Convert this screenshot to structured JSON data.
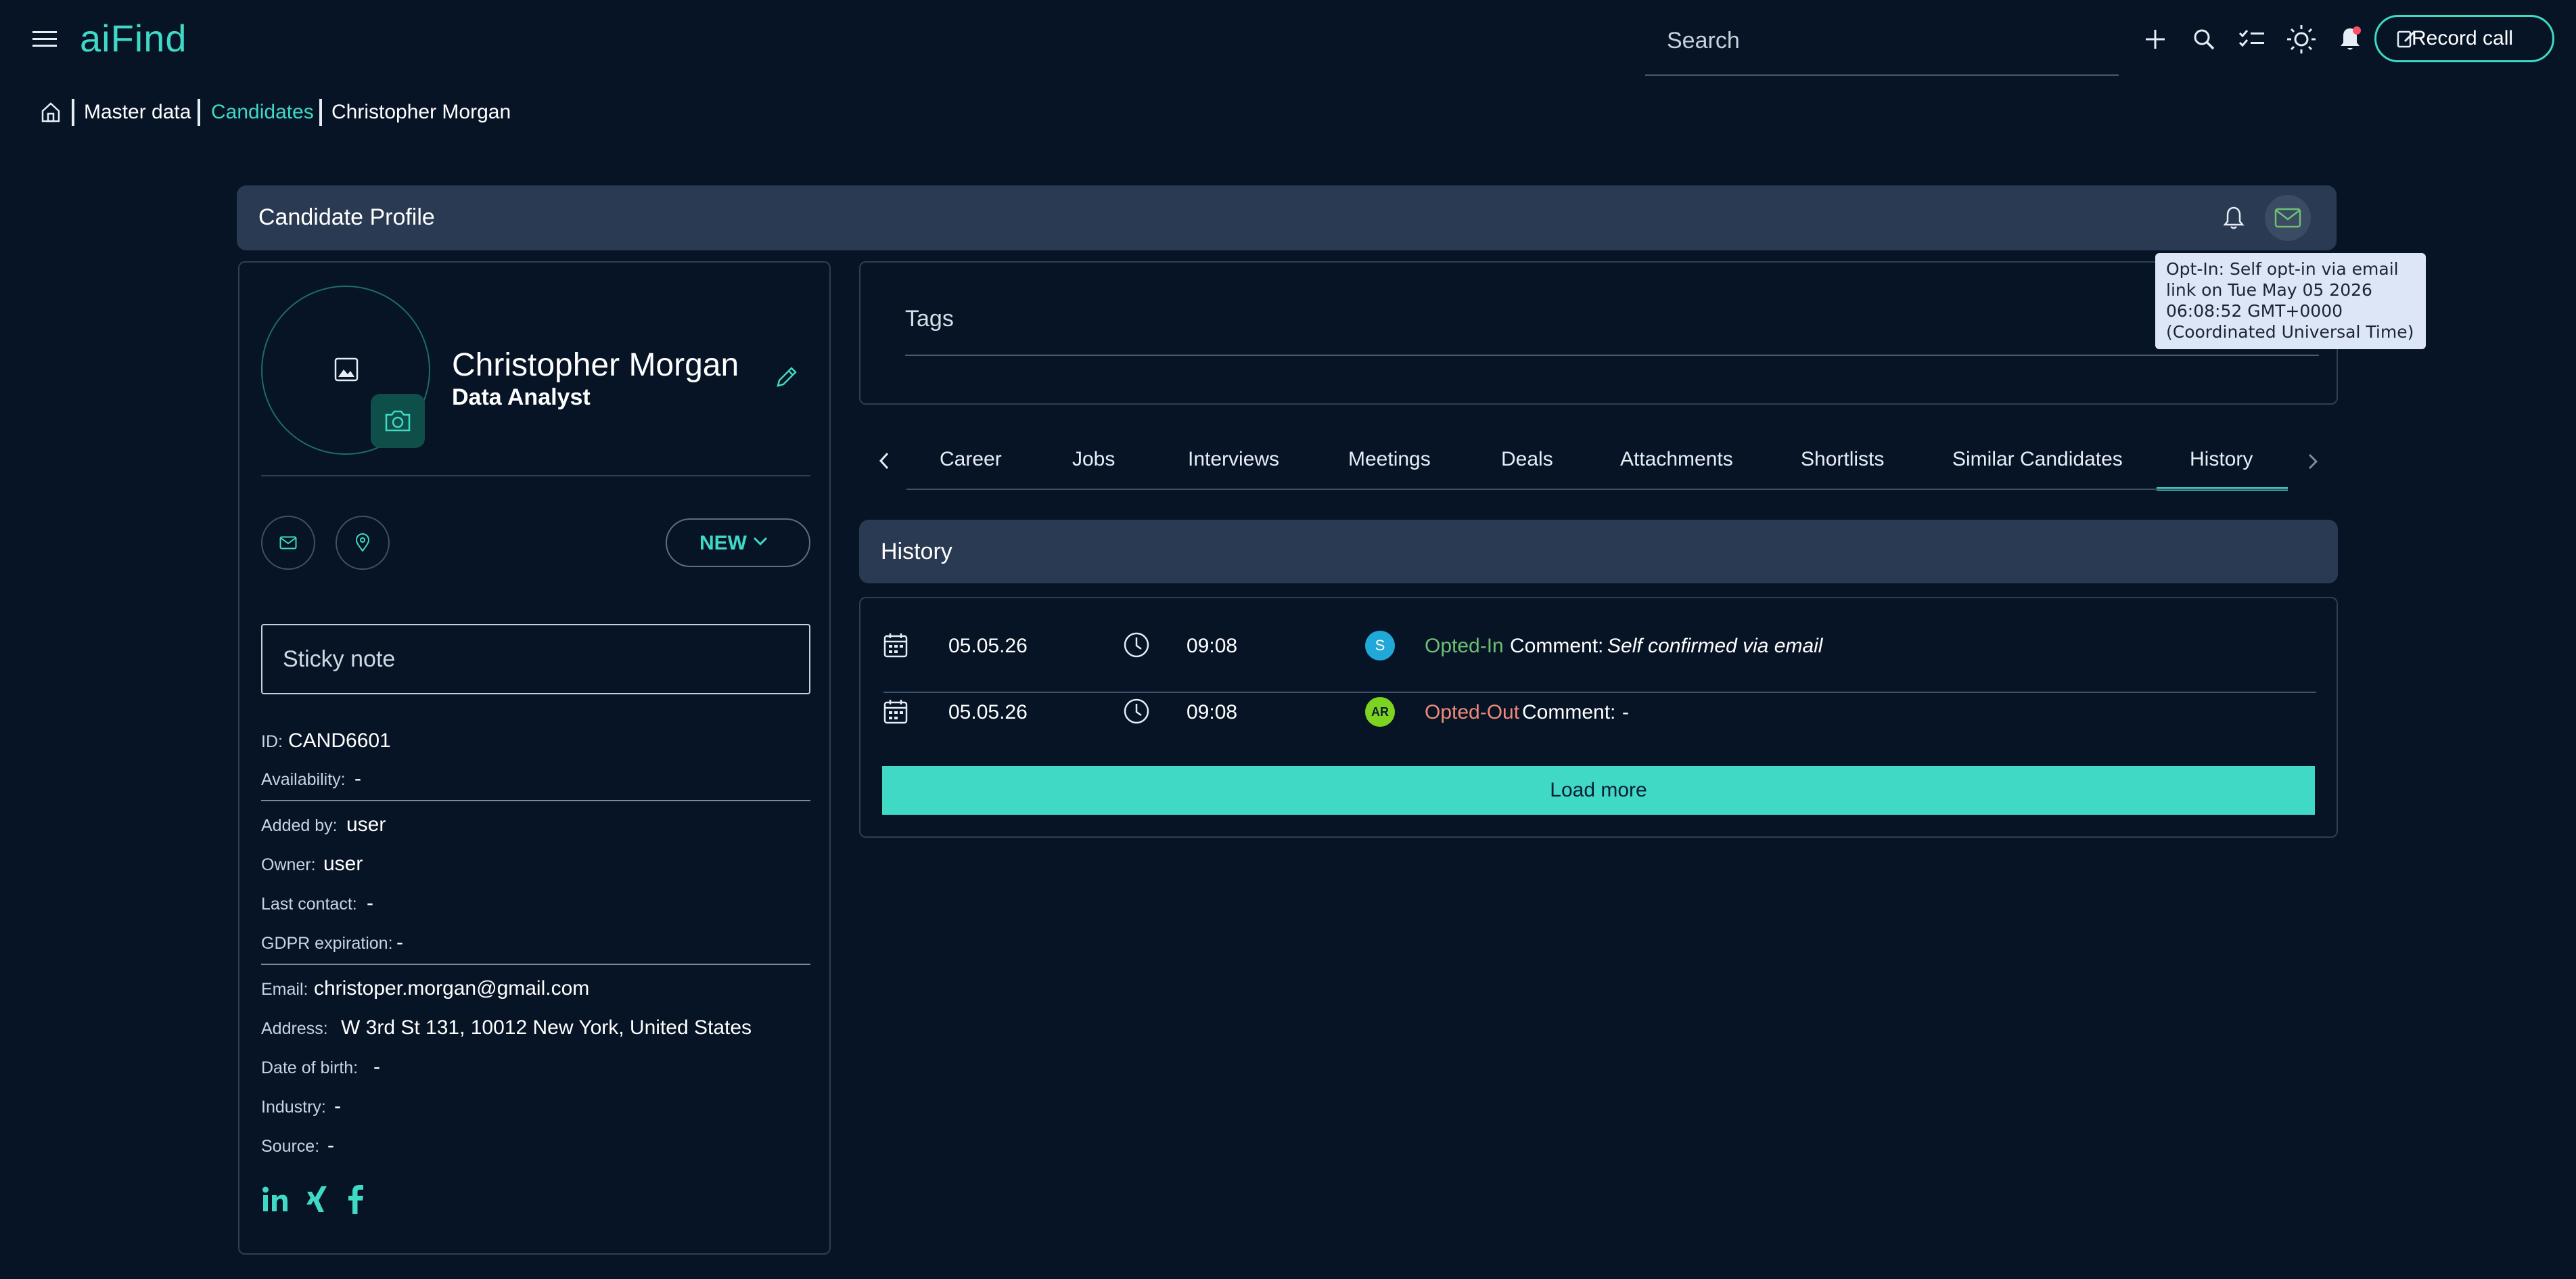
{
  "app": {
    "logo": "aiFind"
  },
  "topbar": {
    "search_placeholder": "Search",
    "record_call_label": "Record call"
  },
  "breadcrumb": {
    "items": [
      "Master data",
      "Candidates",
      "Christopher Morgan"
    ]
  },
  "profile_header": {
    "title": "Candidate Profile"
  },
  "tooltip": {
    "text": "Opt-In: Self opt-in via email link on Tue May 05 2026 06:08:52 GMT+0000 (Coordinated Universal Time)"
  },
  "candidate": {
    "name": "Christopher Morgan",
    "title": "Data Analyst",
    "status": "NEW",
    "sticky_note_placeholder": "Sticky note",
    "fields": {
      "id": {
        "label": "ID:",
        "value": "CAND6601"
      },
      "availability": {
        "label": "Availability:",
        "value": "-"
      },
      "added_by": {
        "label": "Added by:",
        "value": "user"
      },
      "owner": {
        "label": "Owner:",
        "value": "user"
      },
      "last_contact": {
        "label": "Last contact:",
        "value": "-"
      },
      "gdpr": {
        "label": "GDPR expiration:",
        "value": "-"
      },
      "email": {
        "label": "Email:",
        "value": "christoper.morgan@gmail.com"
      },
      "address": {
        "label": "Address:",
        "value": "W 3rd St 131, 10012 New York, United States"
      },
      "dob": {
        "label": "Date of birth:",
        "value": "-"
      },
      "industry": {
        "label": "Industry:",
        "value": "-"
      },
      "source": {
        "label": "Source:",
        "value": "-"
      }
    }
  },
  "tags": {
    "label": "Tags"
  },
  "tabs": [
    "Career",
    "Jobs",
    "Interviews",
    "Meetings",
    "Deals",
    "Attachments",
    "Shortlists",
    "Similar Candidates",
    "History"
  ],
  "active_tab": "History",
  "history": {
    "title": "History",
    "rows": [
      {
        "date": "05.05.26",
        "time": "09:08",
        "avatar": "S",
        "avatar_color": "#1fa8d8",
        "status": "Opted-In",
        "status_color": "#6fbf73",
        "comment_label": "Comment:",
        "comment": "Self confirmed via email"
      },
      {
        "date": "05.05.26",
        "time": "09:08",
        "avatar": "AR",
        "avatar_color": "#7ed321",
        "status": "Opted-Out",
        "status_color": "#f08a7a",
        "comment_label": "Comment:",
        "comment": "-"
      }
    ],
    "load_more_label": "Load more"
  },
  "colors": {
    "accent": "#3fd9c5",
    "background": "#061426",
    "panel": "#2a3a52"
  }
}
